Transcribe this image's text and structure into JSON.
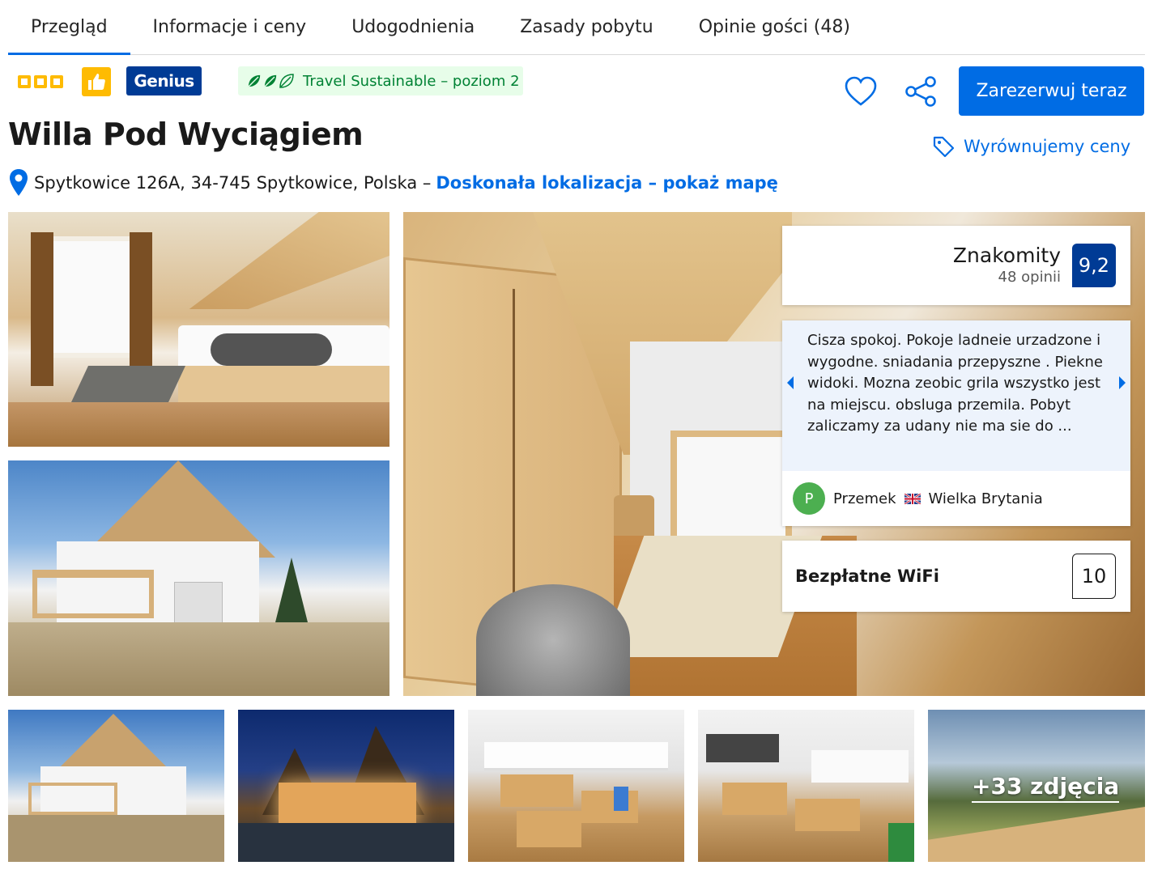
{
  "tabs": [
    {
      "label": "Przegląd",
      "active": true
    },
    {
      "label": "Informacje i ceny",
      "active": false
    },
    {
      "label": "Udogodnienia",
      "active": false
    },
    {
      "label": "Zasady pobytu",
      "active": false
    },
    {
      "label": "Opinie gości (48)",
      "active": false
    }
  ],
  "badges": {
    "stars": 3,
    "genius": "Genius",
    "sustainable": "Travel Sustainable – poziom 2"
  },
  "actions": {
    "book_now": "Zarezerwuj teraz",
    "price_match": "Wyrównujemy ceny"
  },
  "property": {
    "name": "Willa Pod Wyciągiem",
    "address": "Spytkowice 126A, 34-745 Spytkowice, Polska –",
    "map_link": "Doskonała lokalizacja – pokaż mapę"
  },
  "rating": {
    "word": "Znakomity",
    "count": "48 opinii",
    "score": "9,2"
  },
  "review": {
    "text": "Cisza spokoj. Pokoje ladneie urzadzone i wygodne. sniadania przepyszne . Piekne widoki. Mozna zeobic grila wszystko jest na miejscu. obsluga przemila. Pobyt zaliczamy za udany nie ma sie do ...",
    "avatar_initial": "P",
    "author": "Przemek",
    "country": "Wielka Brytania"
  },
  "facility": {
    "label": "Bezpłatne WiFi",
    "score": "10"
  },
  "gallery": {
    "more_photos": "+33 zdjęcia"
  },
  "colors": {
    "brand_blue": "#006ce4",
    "dark_blue": "#003b95",
    "star_yellow": "#febb02",
    "sustain_green": "#008234"
  }
}
